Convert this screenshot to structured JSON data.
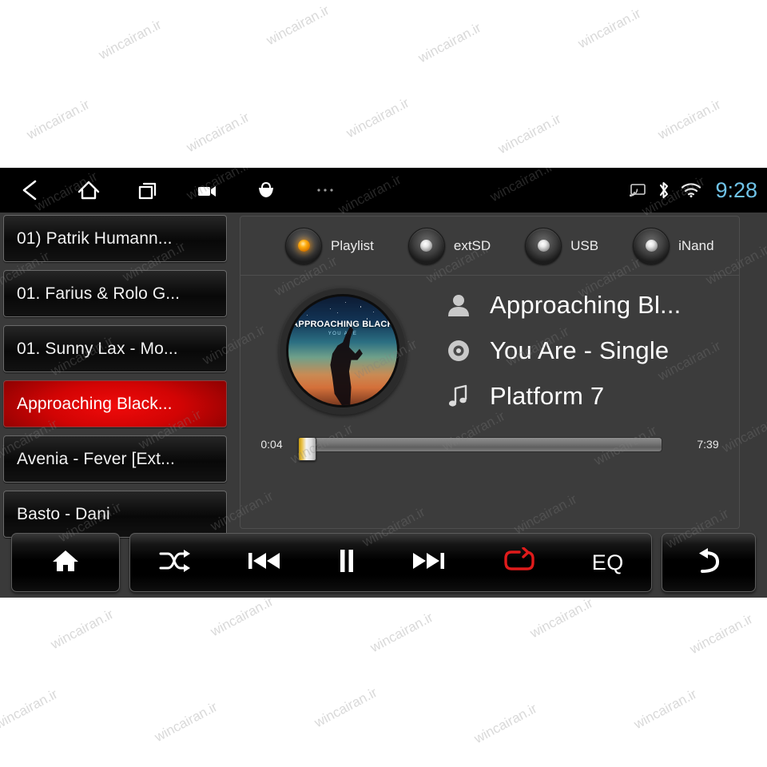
{
  "status_bar": {
    "nav_icons": [
      "back-icon",
      "home-icon",
      "recents-icon",
      "camcorder-icon",
      "basket-icon",
      "more-icon"
    ],
    "sys_icons": [
      "cast-icon",
      "bluetooth-icon",
      "wifi-icon"
    ],
    "clock": "9:28",
    "clock_color": "#6fc3e8"
  },
  "playlist": {
    "items": [
      {
        "label": "01) Patrik Humann...",
        "selected": false
      },
      {
        "label": "01. Farius & Rolo G...",
        "selected": false
      },
      {
        "label": "01. Sunny Lax - Mo...",
        "selected": false
      },
      {
        "label": "Approaching Black...",
        "selected": true
      },
      {
        "label": "Avenia - Fever [Ext...",
        "selected": false
      },
      {
        "label": "Basto - Dani",
        "selected": false
      }
    ],
    "selected_color": "#d20404"
  },
  "sources": {
    "options": [
      {
        "label": "Playlist",
        "active": true
      },
      {
        "label": "extSD",
        "active": false
      },
      {
        "label": "USB",
        "active": false
      },
      {
        "label": "iNand",
        "active": false
      }
    ],
    "active_led_color": "#ffae10"
  },
  "album_art": {
    "title": "APPROACHING BLACK",
    "subtitle": "YOU ARE",
    "icon": "album-art-disc"
  },
  "now_playing": {
    "rows": [
      {
        "icon": "person-icon",
        "text": "Approaching Bl..."
      },
      {
        "icon": "disc-icon",
        "text": "You Are - Single"
      },
      {
        "icon": "music-note-icon",
        "text": "Platform 7"
      }
    ]
  },
  "progress": {
    "elapsed": "0:04",
    "duration": "7:39",
    "percent": 1
  },
  "controls": {
    "home": {
      "label": "home-icon"
    },
    "main": [
      {
        "icon": "shuffle-icon",
        "name": "shuffle-button",
        "active": false
      },
      {
        "icon": "previous-icon",
        "name": "previous-button",
        "active": false
      },
      {
        "icon": "pause-icon",
        "name": "pause-button",
        "active": false
      },
      {
        "icon": "next-icon",
        "name": "next-button",
        "active": false
      },
      {
        "icon": "repeat-icon",
        "name": "repeat-button",
        "active": true
      },
      {
        "icon": "eq-label",
        "name": "eq-button",
        "active": false,
        "label": "EQ"
      }
    ],
    "back": {
      "label": "back-arrow-icon"
    },
    "active_color": "#e01b1b"
  },
  "watermark": {
    "text": "wincairan.ir"
  }
}
